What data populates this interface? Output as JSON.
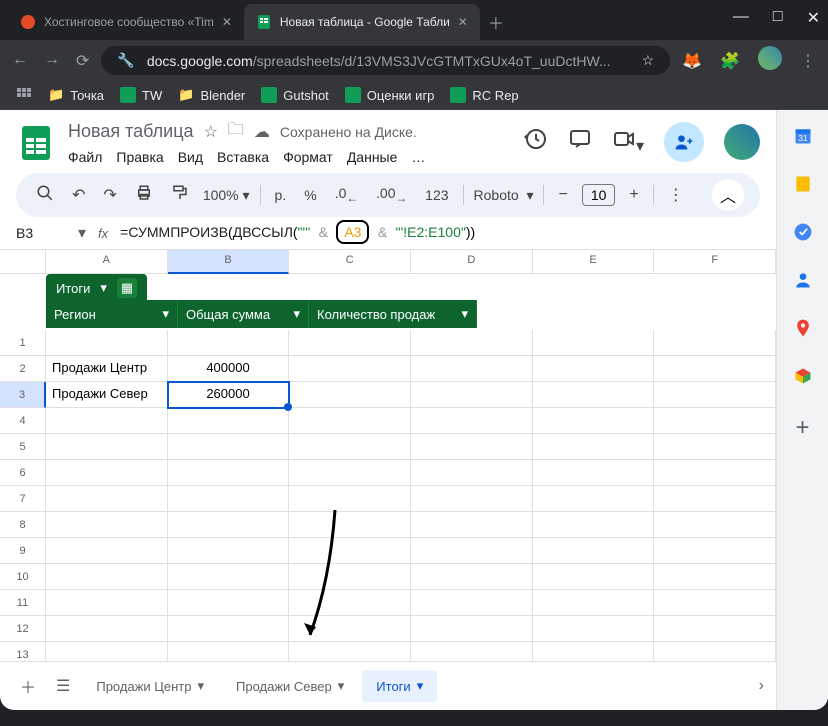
{
  "browser": {
    "tabs": [
      {
        "title": "Хостинговое сообщество «Tim",
        "favicon_color": "#e34c26"
      },
      {
        "title": "Новая таблица - Google Табли",
        "favicon_color": "#0f9d58"
      }
    ],
    "url_host": "docs.google.com",
    "url_path": "/spreadsheets/d/13VMS3JVcGTMTxGUx4oT_uuDctHW...",
    "bookmarks": [
      {
        "label": "Точка",
        "type": "folder"
      },
      {
        "label": "TW",
        "type": "sheet"
      },
      {
        "label": "Blender",
        "type": "folder"
      },
      {
        "label": "Gutshot",
        "type": "sheet"
      },
      {
        "label": "Оценки игр",
        "type": "sheet"
      },
      {
        "label": "RC Rep",
        "type": "sheet"
      }
    ]
  },
  "doc": {
    "title": "Новая таблица",
    "saved_label": "Сохранено на Диске.",
    "menus": [
      "Файл",
      "Правка",
      "Вид",
      "Вставка",
      "Формат",
      "Данные"
    ]
  },
  "toolbar": {
    "zoom": "100%",
    "currency": "р.",
    "percent": "%",
    "dec_dec": ".0",
    "inc_dec": ".00",
    "num123": "123",
    "font": "Roboto",
    "font_size": "10"
  },
  "formula": {
    "cell_ref": "B3",
    "parts": {
      "p1": "=СУММПРОИЗВ",
      "p2": "(",
      "p3": "ДВССЫЛ",
      "p4": "(",
      "str1": "\"'\"",
      "amp": "&",
      "ref": "A3",
      "amp2": "&",
      "str2": "\"'!E2:E100\"",
      "p5": "))"
    }
  },
  "columns": [
    "A",
    "B",
    "C",
    "D",
    "E",
    "F"
  ],
  "table": {
    "banner": "Итоги",
    "headers": [
      "Регион",
      "Общая сумма",
      "Количество продаж"
    ],
    "rows": [
      {
        "region": "Продажи Центр",
        "sum": "400000",
        "qty": ""
      },
      {
        "region": "Продажи Север",
        "sum": "260000",
        "qty": ""
      }
    ]
  },
  "sheet_tabs": [
    "Продажи Центр",
    "Продажи Север",
    "Итоги"
  ],
  "chart_data": null
}
